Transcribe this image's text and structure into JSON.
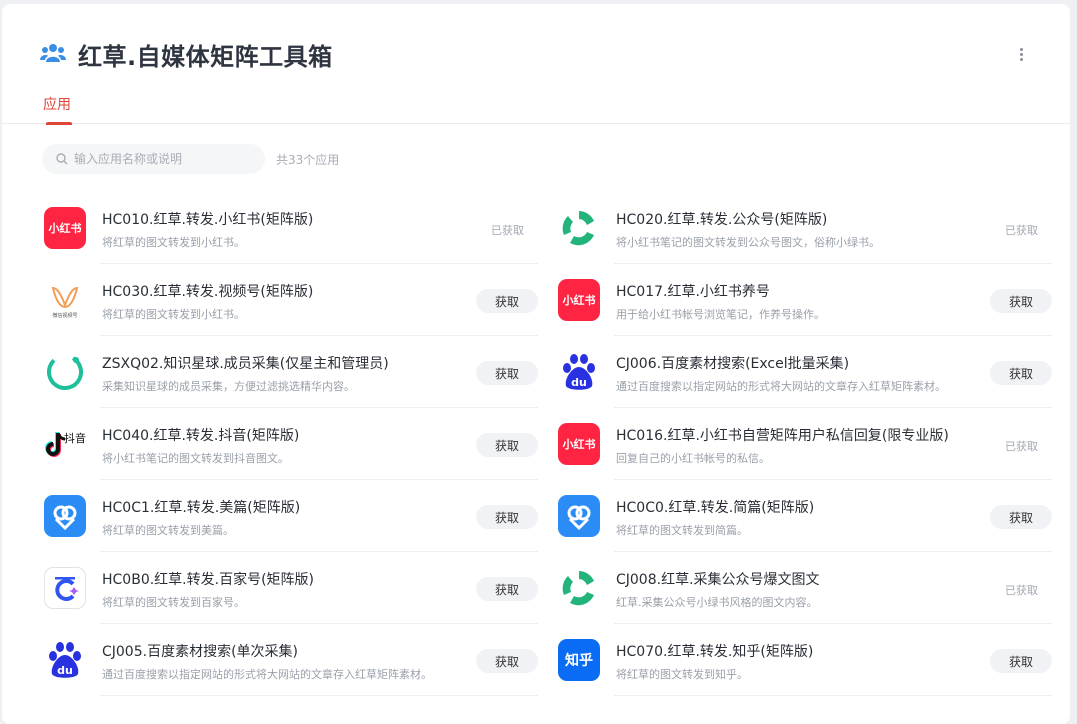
{
  "header": {
    "title": "红草.自媒体矩阵工具箱",
    "tab_label": "应用"
  },
  "search": {
    "placeholder": "输入应用名称或说明",
    "count_text": "共33个应用"
  },
  "labels": {
    "get": "获取",
    "got": "已获取"
  },
  "brand_colors": {
    "accent": "#e0453a",
    "xiaohongshu": "#ff2442",
    "meipian": "#2a8cf4",
    "zhihu": "#0a6cf5",
    "wechat_green": "#22b47a",
    "baidu_blue": "#2932e1"
  },
  "apps": [
    {
      "name": "HC010.红草.转发.小红书(矩阵版)",
      "desc": "将红草的图文转发到小红书。",
      "status": "got",
      "icon": "xiaohongshu-icon",
      "logo_text": "小红书"
    },
    {
      "name": "HC020.红草.转发.公众号(矩阵版)",
      "desc": "将小红书笔记的图文转发到公众号图文，俗称小绿书。",
      "status": "got",
      "icon": "wechat-official-account-icon",
      "logo_text": ""
    },
    {
      "name": "HC030.红草.转发.视频号(矩阵版)",
      "desc": "将红草的图文转发到小红书。",
      "status": "get",
      "icon": "wechat-channels-icon",
      "logo_text": "微信视频号"
    },
    {
      "name": "HC017.红草.小红书养号",
      "desc": "用于给小红书帐号浏览笔记，作养号操作。",
      "status": "get",
      "icon": "xiaohongshu-icon",
      "logo_text": "小红书"
    },
    {
      "name": "ZSXQ02.知识星球.成员采集(仅星主和管理员)",
      "desc": "采集知识星球的成员采集，方便过滤挑选精华内容。",
      "status": "get",
      "icon": "zsxq-icon",
      "logo_text": ""
    },
    {
      "name": "CJ006.百度素材搜索(Excel批量采集)",
      "desc": "通过百度搜索以指定网站的形式将大网站的文章存入红草矩阵素材。",
      "status": "get",
      "icon": "baidu-icon",
      "logo_text": "du"
    },
    {
      "name": "HC040.红草.转发.抖音(矩阵版)",
      "desc": "将小红书笔记的图文转发到抖音图文。",
      "status": "get",
      "icon": "douyin-icon",
      "logo_text": "抖音"
    },
    {
      "name": "HC016.红草.小红书自营矩阵用户私信回复(限专业版)",
      "desc": "回复自己的小红书帐号的私信。",
      "status": "got",
      "icon": "xiaohongshu-icon",
      "logo_text": "小红书"
    },
    {
      "name": "HC0C1.红草.转发.美篇(矩阵版)",
      "desc": "将红草的图文转发到美篇。",
      "status": "get",
      "icon": "meipian-icon",
      "logo_text": ""
    },
    {
      "name": "HC0C0.红草.转发.简篇(矩阵版)",
      "desc": "将红草的图文转发到简篇。",
      "status": "get",
      "icon": "jianpian-icon",
      "logo_text": ""
    },
    {
      "name": "HC0B0.红草.转发.百家号(矩阵版)",
      "desc": "将红草的图文转发到百家号。",
      "status": "get",
      "icon": "baijiahao-icon",
      "logo_text": ""
    },
    {
      "name": "CJ008.红草.采集公众号爆文图文",
      "desc": "红草.采集公众号小绿书风格的图文内容。",
      "status": "got",
      "icon": "wechat-official-account-icon",
      "logo_text": ""
    },
    {
      "name": "CJ005.百度素材搜索(单次采集)",
      "desc": "通过百度搜索以指定网站的形式将大网站的文章存入红草矩阵素材。",
      "status": "get",
      "icon": "baidu-icon",
      "logo_text": "du"
    },
    {
      "name": "HC070.红草.转发.知乎(矩阵版)",
      "desc": "将红草的图文转发到知乎。",
      "status": "get",
      "icon": "zhihu-icon",
      "logo_text": "知乎"
    }
  ]
}
